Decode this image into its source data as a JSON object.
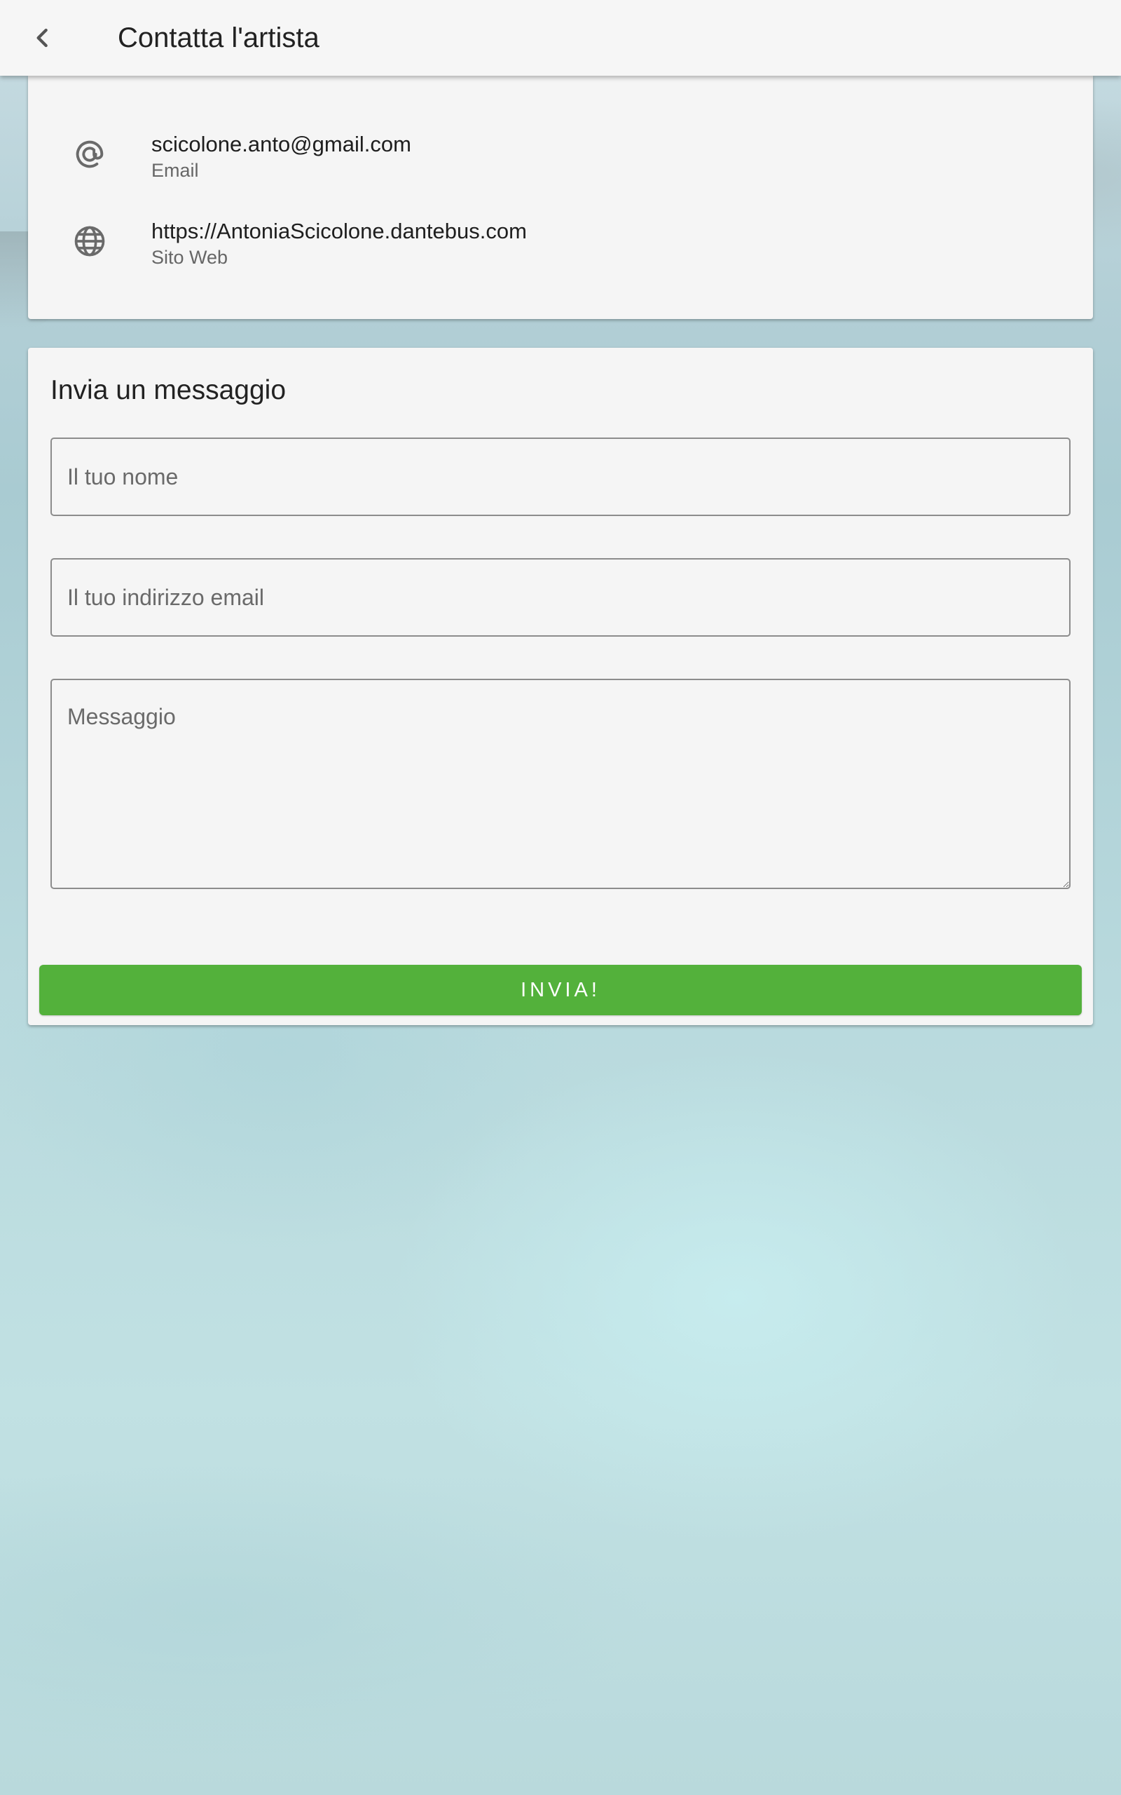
{
  "appbar": {
    "title": "Contatta l'artista",
    "back_icon": "chevron-left-icon"
  },
  "contacts": [
    {
      "icon": "at-sign-icon",
      "value": "scicolone.anto@gmail.com",
      "label": "Email"
    },
    {
      "icon": "globe-icon",
      "value": "https://AntoniaScicolone.dantebus.com",
      "label": "Sito Web"
    }
  ],
  "form": {
    "title": "Invia un messaggio",
    "name_placeholder": "Il tuo nome",
    "name_value": "",
    "email_placeholder": "Il tuo indirizzo email",
    "email_value": "",
    "message_placeholder": "Messaggio",
    "message_value": "",
    "submit_label": "INVIA!"
  },
  "colors": {
    "accent": "#53b13b",
    "surface": "#f5f5f5",
    "appbar": "#f6f6f6"
  }
}
